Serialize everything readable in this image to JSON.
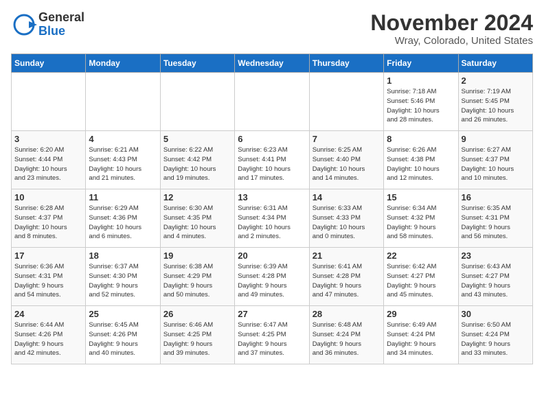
{
  "header": {
    "logo_general": "General",
    "logo_blue": "Blue",
    "title": "November 2024",
    "subtitle": "Wray, Colorado, United States"
  },
  "weekdays": [
    "Sunday",
    "Monday",
    "Tuesday",
    "Wednesday",
    "Thursday",
    "Friday",
    "Saturday"
  ],
  "weeks": [
    [
      {
        "day": "",
        "info": ""
      },
      {
        "day": "",
        "info": ""
      },
      {
        "day": "",
        "info": ""
      },
      {
        "day": "",
        "info": ""
      },
      {
        "day": "",
        "info": ""
      },
      {
        "day": "1",
        "info": "Sunrise: 7:18 AM\nSunset: 5:46 PM\nDaylight: 10 hours\nand 28 minutes."
      },
      {
        "day": "2",
        "info": "Sunrise: 7:19 AM\nSunset: 5:45 PM\nDaylight: 10 hours\nand 26 minutes."
      }
    ],
    [
      {
        "day": "3",
        "info": "Sunrise: 6:20 AM\nSunset: 4:44 PM\nDaylight: 10 hours\nand 23 minutes."
      },
      {
        "day": "4",
        "info": "Sunrise: 6:21 AM\nSunset: 4:43 PM\nDaylight: 10 hours\nand 21 minutes."
      },
      {
        "day": "5",
        "info": "Sunrise: 6:22 AM\nSunset: 4:42 PM\nDaylight: 10 hours\nand 19 minutes."
      },
      {
        "day": "6",
        "info": "Sunrise: 6:23 AM\nSunset: 4:41 PM\nDaylight: 10 hours\nand 17 minutes."
      },
      {
        "day": "7",
        "info": "Sunrise: 6:25 AM\nSunset: 4:40 PM\nDaylight: 10 hours\nand 14 minutes."
      },
      {
        "day": "8",
        "info": "Sunrise: 6:26 AM\nSunset: 4:38 PM\nDaylight: 10 hours\nand 12 minutes."
      },
      {
        "day": "9",
        "info": "Sunrise: 6:27 AM\nSunset: 4:37 PM\nDaylight: 10 hours\nand 10 minutes."
      }
    ],
    [
      {
        "day": "10",
        "info": "Sunrise: 6:28 AM\nSunset: 4:37 PM\nDaylight: 10 hours\nand 8 minutes."
      },
      {
        "day": "11",
        "info": "Sunrise: 6:29 AM\nSunset: 4:36 PM\nDaylight: 10 hours\nand 6 minutes."
      },
      {
        "day": "12",
        "info": "Sunrise: 6:30 AM\nSunset: 4:35 PM\nDaylight: 10 hours\nand 4 minutes."
      },
      {
        "day": "13",
        "info": "Sunrise: 6:31 AM\nSunset: 4:34 PM\nDaylight: 10 hours\nand 2 minutes."
      },
      {
        "day": "14",
        "info": "Sunrise: 6:33 AM\nSunset: 4:33 PM\nDaylight: 10 hours\nand 0 minutes."
      },
      {
        "day": "15",
        "info": "Sunrise: 6:34 AM\nSunset: 4:32 PM\nDaylight: 9 hours\nand 58 minutes."
      },
      {
        "day": "16",
        "info": "Sunrise: 6:35 AM\nSunset: 4:31 PM\nDaylight: 9 hours\nand 56 minutes."
      }
    ],
    [
      {
        "day": "17",
        "info": "Sunrise: 6:36 AM\nSunset: 4:31 PM\nDaylight: 9 hours\nand 54 minutes."
      },
      {
        "day": "18",
        "info": "Sunrise: 6:37 AM\nSunset: 4:30 PM\nDaylight: 9 hours\nand 52 minutes."
      },
      {
        "day": "19",
        "info": "Sunrise: 6:38 AM\nSunset: 4:29 PM\nDaylight: 9 hours\nand 50 minutes."
      },
      {
        "day": "20",
        "info": "Sunrise: 6:39 AM\nSunset: 4:28 PM\nDaylight: 9 hours\nand 49 minutes."
      },
      {
        "day": "21",
        "info": "Sunrise: 6:41 AM\nSunset: 4:28 PM\nDaylight: 9 hours\nand 47 minutes."
      },
      {
        "day": "22",
        "info": "Sunrise: 6:42 AM\nSunset: 4:27 PM\nDaylight: 9 hours\nand 45 minutes."
      },
      {
        "day": "23",
        "info": "Sunrise: 6:43 AM\nSunset: 4:27 PM\nDaylight: 9 hours\nand 43 minutes."
      }
    ],
    [
      {
        "day": "24",
        "info": "Sunrise: 6:44 AM\nSunset: 4:26 PM\nDaylight: 9 hours\nand 42 minutes."
      },
      {
        "day": "25",
        "info": "Sunrise: 6:45 AM\nSunset: 4:26 PM\nDaylight: 9 hours\nand 40 minutes."
      },
      {
        "day": "26",
        "info": "Sunrise: 6:46 AM\nSunset: 4:25 PM\nDaylight: 9 hours\nand 39 minutes."
      },
      {
        "day": "27",
        "info": "Sunrise: 6:47 AM\nSunset: 4:25 PM\nDaylight: 9 hours\nand 37 minutes."
      },
      {
        "day": "28",
        "info": "Sunrise: 6:48 AM\nSunset: 4:24 PM\nDaylight: 9 hours\nand 36 minutes."
      },
      {
        "day": "29",
        "info": "Sunrise: 6:49 AM\nSunset: 4:24 PM\nDaylight: 9 hours\nand 34 minutes."
      },
      {
        "day": "30",
        "info": "Sunrise: 6:50 AM\nSunset: 4:24 PM\nDaylight: 9 hours\nand 33 minutes."
      }
    ]
  ]
}
